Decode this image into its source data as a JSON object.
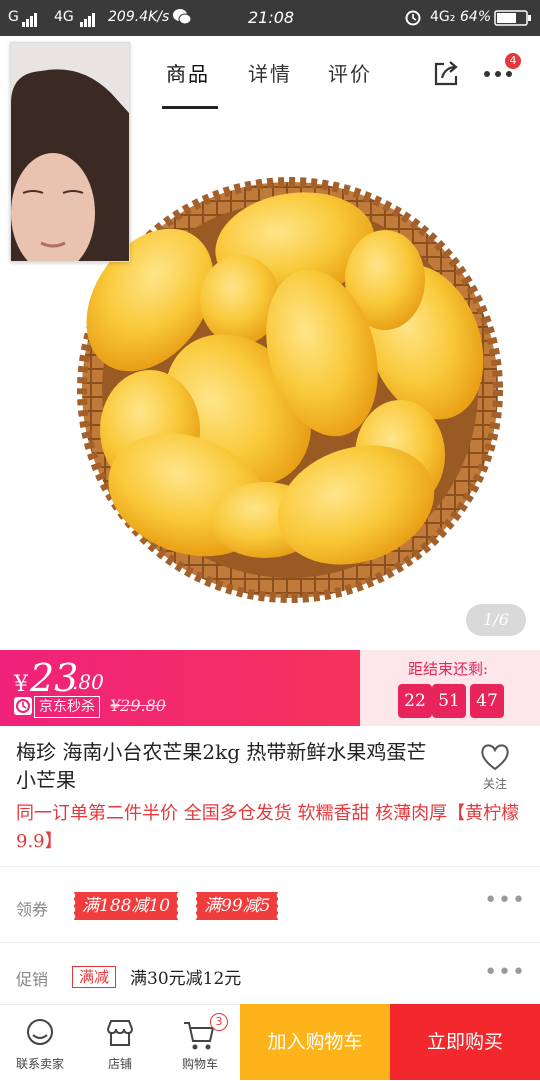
{
  "status_bar": {
    "carrier1": "G",
    "carrier2": "4G",
    "speed": "209.4K/s",
    "time": "21:08",
    "network2": "4G₂",
    "battery": "64%"
  },
  "nav": {
    "tabs": [
      {
        "label": "商品"
      },
      {
        "label": "详情"
      },
      {
        "label": "评价"
      }
    ],
    "more_badge": "4"
  },
  "gallery": {
    "pager": "1/6"
  },
  "price": {
    "currency": "¥",
    "integer": "23",
    "decimal": ".80",
    "seckill_label": "京东秒杀",
    "original": "¥29.80",
    "countdown_title": "距结束还剩:",
    "countdown": {
      "h": "22",
      "m": "51",
      "s": "47"
    }
  },
  "product": {
    "title": "梅珍 海南小台农芒果2kg 热带新鲜水果鸡蛋芒小芒果",
    "follow_label": "关注",
    "promo": "同一订单第二件半价 全国多仓发货 软糯香甜 核薄肉厚",
    "promo_link": "【黄柠檬9.9】"
  },
  "coupons": {
    "label": "领券",
    "items": [
      "满188减10",
      "满99减5"
    ]
  },
  "promotion": {
    "label": "促销",
    "tag": "满减",
    "text": "满30元减12元"
  },
  "bottom": {
    "contact": "联系卖家",
    "shop": "店铺",
    "cart": "购物车",
    "cart_badge": "3",
    "add_cart": "加入购物车",
    "buy_now": "立即购买"
  },
  "colors": {
    "accent_red": "#e4393c",
    "price_pink": "#f0217b",
    "add_cart": "#ffb31a",
    "buy_now": "#f2282c"
  }
}
